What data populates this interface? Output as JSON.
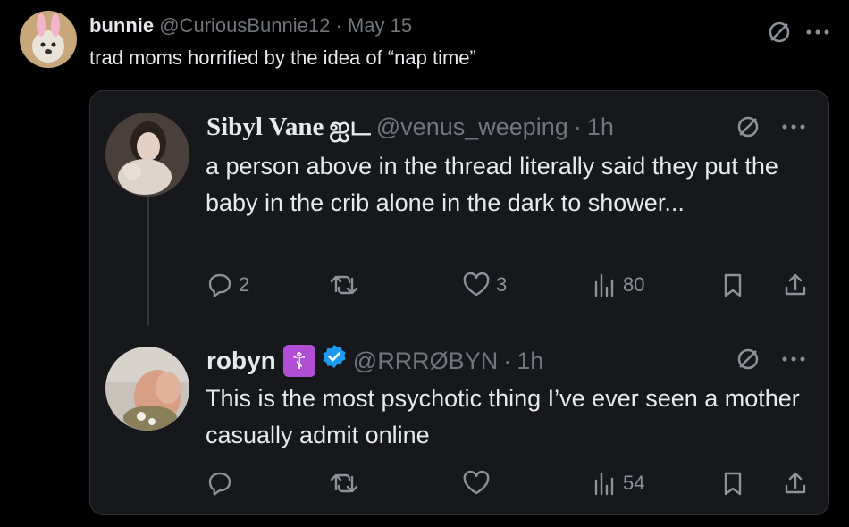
{
  "outer_tweet": {
    "display_name": "bunnie",
    "handle": "@CuriousBunnie12",
    "separator": "·",
    "date": "May 15",
    "text": "trad moms horrified by the idea of “nap time”",
    "more_icon": "ellipsis-icon",
    "grok_icon": "slash-circle-icon"
  },
  "reply_1": {
    "display_name": "Sibyl Vane",
    "name_suffix": "ஐட",
    "handle": "@venus_weeping",
    "separator": "·",
    "time": "1h",
    "text": "a person above in the thread literally said they put the baby in the crib alone in the dark to shower...",
    "replies": "2",
    "reposts": "",
    "likes": "3",
    "views": "80"
  },
  "reply_2": {
    "display_name": "robyn",
    "name_emoji": "☦",
    "verified": true,
    "handle": "@RRRØBYN",
    "separator": "·",
    "time": "1h",
    "text": "This is the most psychotic thing I’ve ever seen a mother casually admit online",
    "replies": "",
    "reposts": "",
    "likes": "",
    "views": "54"
  },
  "colors": {
    "background": "#000000",
    "card": "#16181c",
    "text": "#e7e9ea",
    "muted": "#71767b",
    "verified_blue": "#1d9bf0",
    "emoji_purple": "#b04fd6"
  }
}
